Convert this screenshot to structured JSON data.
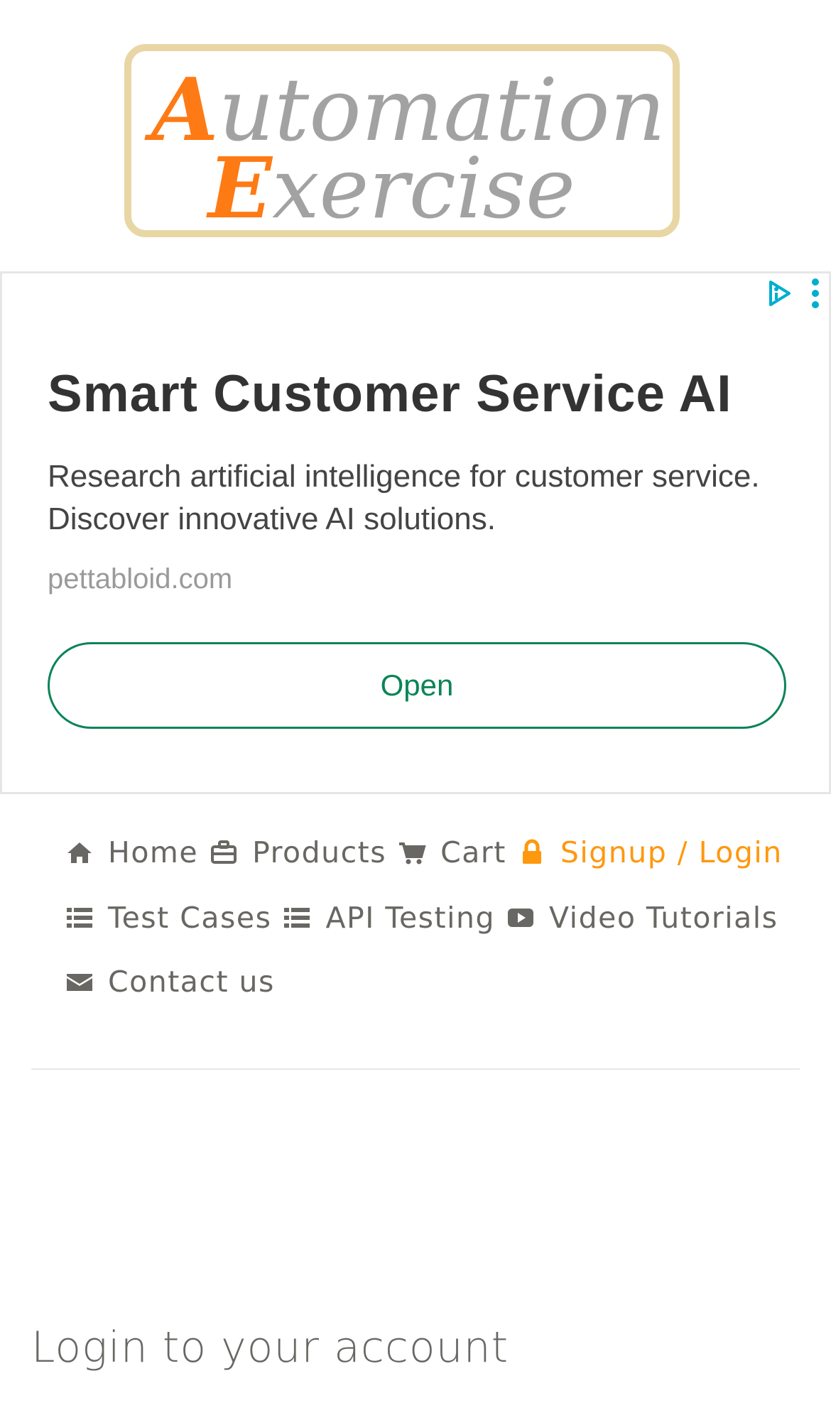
{
  "logo": {
    "line1_cap": "A",
    "line1_rest": "utomation",
    "line2_cap": "E",
    "line2_rest": "xercise",
    "colors": {
      "accent": "#fe7a15",
      "text": "#a2a2a2",
      "border": "#e8d6a4"
    }
  },
  "ad": {
    "title": "Smart Customer Service AI",
    "description": "Research artificial intelligence for customer service. Discover innovative AI solutions.",
    "domain": "pettabloid.com",
    "cta_label": "Open",
    "icons": [
      "adchoices-icon",
      "more-vertical-icon"
    ],
    "colors": {
      "cta": "#0b8457",
      "adchoices": "#00aecd"
    }
  },
  "nav": {
    "items": [
      {
        "label": "Home",
        "icon": "home-icon",
        "active": false
      },
      {
        "label": "Products",
        "icon": "briefcase-icon",
        "active": false
      },
      {
        "label": "Cart",
        "icon": "cart-icon",
        "active": false
      },
      {
        "label": "Signup / Login",
        "icon": "lock-icon",
        "active": true
      },
      {
        "label": "Test Cases",
        "icon": "list-icon",
        "active": false
      },
      {
        "label": "API Testing",
        "icon": "list-icon",
        "active": false
      },
      {
        "label": "Video Tutorials",
        "icon": "youtube-play-icon",
        "active": false
      },
      {
        "label": "Contact us",
        "icon": "envelope-icon",
        "active": false
      }
    ],
    "colors": {
      "default": "#696763",
      "active": "#fe980f"
    }
  },
  "login": {
    "title": "Login to your account"
  }
}
